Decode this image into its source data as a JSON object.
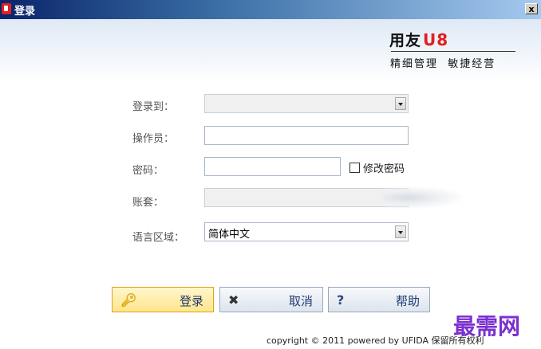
{
  "window": {
    "title": "登录",
    "close_label": "x"
  },
  "brand": {
    "name": "用友",
    "product": "U8",
    "slogan": "精细管理  敏捷经营"
  },
  "form": {
    "login_to_label": "登录到：",
    "login_to_value": "",
    "operator_label": "操作员：",
    "operator_value": "",
    "password_label": "密码：",
    "password_value": "",
    "change_password_label": "修改密码",
    "change_password_checked": false,
    "account_label": "账套：",
    "account_value": "",
    "language_label": "语言区域：",
    "language_value": "简体中文"
  },
  "buttons": {
    "login": "登录",
    "cancel": "取消",
    "help": "帮助"
  },
  "footer": {
    "copyright": "copyright © 2011 powered by UFIDA 保留所有权利"
  },
  "watermark": "最需网",
  "icons": {
    "login": "key-icon",
    "cancel": "close-icon",
    "help": "help-icon"
  }
}
